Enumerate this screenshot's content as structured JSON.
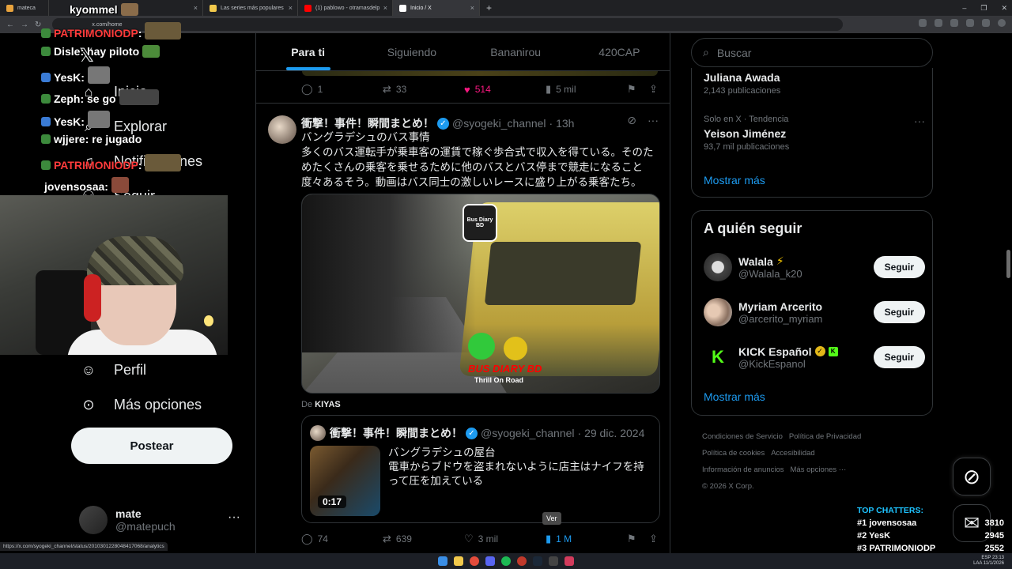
{
  "browser": {
    "tabs": [
      {
        "label": "mateca",
        "color": "#e8a33d"
      },
      {
        "label": "Las series más populares",
        "color": "#f2c94c"
      },
      {
        "label": "(1) pablowo - otramasdelp",
        "color": "#ff0000"
      },
      {
        "label": "Inicio / X",
        "color": "#ffffff"
      }
    ],
    "url": "x.com/home",
    "status_url": "https://x.com/syogeki_channel/status/2010301228048417068/analytics"
  },
  "nav": {
    "items": [
      {
        "label": "Inicio",
        "icon": "home-icon"
      },
      {
        "label": "Explorar",
        "icon": "search-icon"
      },
      {
        "label": "Notificaciones",
        "icon": "bell-icon"
      },
      {
        "label": "Seguir",
        "icon": "people-icon"
      },
      {
        "label": "Perfil",
        "icon": "person-icon"
      },
      {
        "label": "Más opciones",
        "icon": "more-circle-icon"
      }
    ],
    "post_button": "Postear",
    "account": {
      "name": "mate",
      "handle": "@matepuch",
      "more": "···"
    }
  },
  "stream_chat": [
    {
      "user": "kyommel",
      "msg": "",
      "color": "#ffffff"
    },
    {
      "user": "PATRIMONIODP",
      "msg": ":",
      "color": "#ff3b3b"
    },
    {
      "user": "Disle",
      "msg": ": hay piloto",
      "color": "#ffffff"
    },
    {
      "user": "YesK",
      "msg": ":",
      "color": "#ffffff"
    },
    {
      "user": "Zeph",
      "msg": ": se go",
      "color": "#ffffff"
    },
    {
      "user": "YesK",
      "msg": ":",
      "color": "#ffffff"
    },
    {
      "user": "wjjere",
      "msg": ": re jugado",
      "color": "#ffffff"
    },
    {
      "user": "PATRIMONIODP",
      "msg": ":",
      "color": "#ff3b3b"
    },
    {
      "user": "jovensosaa",
      "msg": ":",
      "color": "#ffffff"
    }
  ],
  "timeline": {
    "tabs": [
      "Para ti",
      "Siguiendo",
      "Bananirou",
      "420CAP"
    ],
    "active_tab": "Para ti",
    "prev_actions": {
      "replies": "1",
      "reposts": "33",
      "likes": "514",
      "views": "5 mil"
    },
    "tweet": {
      "name": "衝撃！事件！瞬間まとめ！",
      "handle": "@syogeki_channel",
      "time": "· 13h",
      "text": "バングラデシュのバス事情\n多くのバス運転手が乗車客の運賃で稼ぐ歩合式で収入を得ている。そのためたくさんの乗客を乗せるために他のバスとバス停まで競走になること度々あるそう。動画はバス同士の激しいレースに盛り上がる乗客たち。",
      "media_logo": "Bus Diary BD",
      "media_watermark": "BUS DIARY BD",
      "media_watermark2": "Thrill On Road",
      "from_prefix": "De",
      "from_name": "KIYAS",
      "quote": {
        "name": "衝撃！事件！瞬間まとめ！",
        "handle": "@syogeki_channel",
        "time": "· 29 dic. 2024",
        "text": "バングラデシュの屋台\n電車からブドウを盗まれないように店主はナイフを持って圧を加えている",
        "duration": "0:17"
      },
      "actions": {
        "replies": "74",
        "reposts": "639",
        "likes": "3 mil",
        "views": "1 M"
      },
      "tooltip": "Ver"
    }
  },
  "sidebar": {
    "search_placeholder": "Buscar",
    "trends": [
      {
        "context": "",
        "title": "Juliana Awada",
        "count": "2,143 publicaciones"
      },
      {
        "context": "Solo en X · Tendencia",
        "title": "Yeison Jiménez",
        "count": "93,7 mil publicaciones"
      }
    ],
    "show_more": "Mostrar más",
    "who_to_follow": {
      "title": "A quién seguir",
      "people": [
        {
          "name": "Walala",
          "handle": "@Walala_k20",
          "button": "Seguir",
          "avatar_color": "#d8d8d8"
        },
        {
          "name": "Myriam Arcerito",
          "handle": "@arcerito_myriam",
          "button": "Seguir",
          "avatar_color": "#c9b6a8"
        },
        {
          "name": "KICK Español",
          "handle": "@KickEspanol",
          "button": "Seguir",
          "avatar_color": "#000000"
        }
      ],
      "show_more": "Mostrar más"
    },
    "footer": [
      "Condiciones de Servicio",
      "Política de Privacidad",
      "Política de cookies",
      "Accesibilidad",
      "Información de anuncios",
      "Más opciones ···",
      "© 2026 X Corp."
    ]
  },
  "top_chatters": {
    "title": "TOP CHATTERS:",
    "rows": [
      {
        "rank": "#1",
        "name": "jovensosaa",
        "count": "3810"
      },
      {
        "rank": "#2",
        "name": "YesK",
        "count": "2945"
      },
      {
        "rank": "#3",
        "name": "PATRIMONIODP",
        "count": "2552"
      }
    ]
  },
  "taskbar": {
    "lang1": "ESP",
    "lang2": "LAA",
    "time": "23:13",
    "date": "11/1/2026"
  },
  "colors": {
    "accent": "#1d9bf0",
    "like": "#f91880",
    "background": "#000000"
  }
}
